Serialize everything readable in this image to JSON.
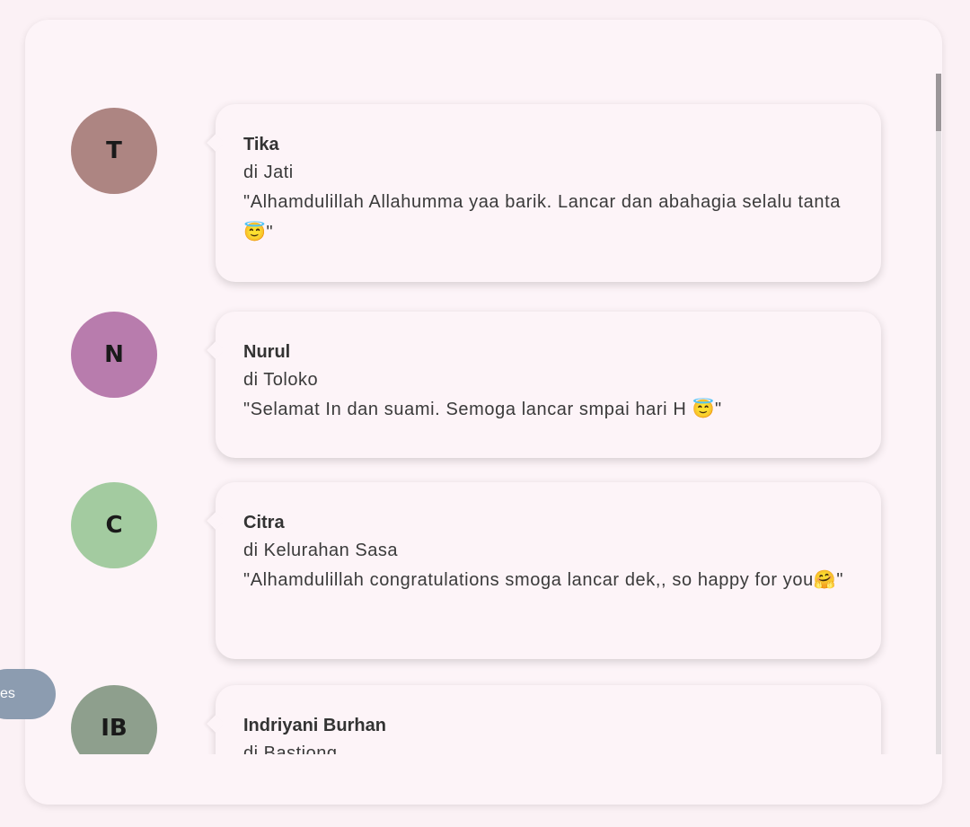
{
  "side_button": {
    "label": "es"
  },
  "wishes": [
    {
      "initials": "T",
      "avatar_color": "#ad8582",
      "name": "Tika",
      "location": "di Jati",
      "message": "\"Alhamdulillah Allahumma yaa barik. Lancar dan abahagia selalu tanta😇\""
    },
    {
      "initials": "N",
      "avatar_color": "#b87cad",
      "name": "Nurul",
      "location": "di Toloko",
      "message": "\"Selamat In dan suami. Semoga lancar smpai hari H 😇\""
    },
    {
      "initials": "C",
      "avatar_color": "#a3cba0",
      "name": "Citra",
      "location": "di Kelurahan Sasa",
      "message": "\"Alhamdulillah congratulations smoga lancar dek,, so happy for you🤗\""
    },
    {
      "initials": "IB",
      "avatar_color": "#8e9f8d",
      "name": "Indriyani Burhan",
      "location": "di Bastiong",
      "message": ""
    }
  ]
}
